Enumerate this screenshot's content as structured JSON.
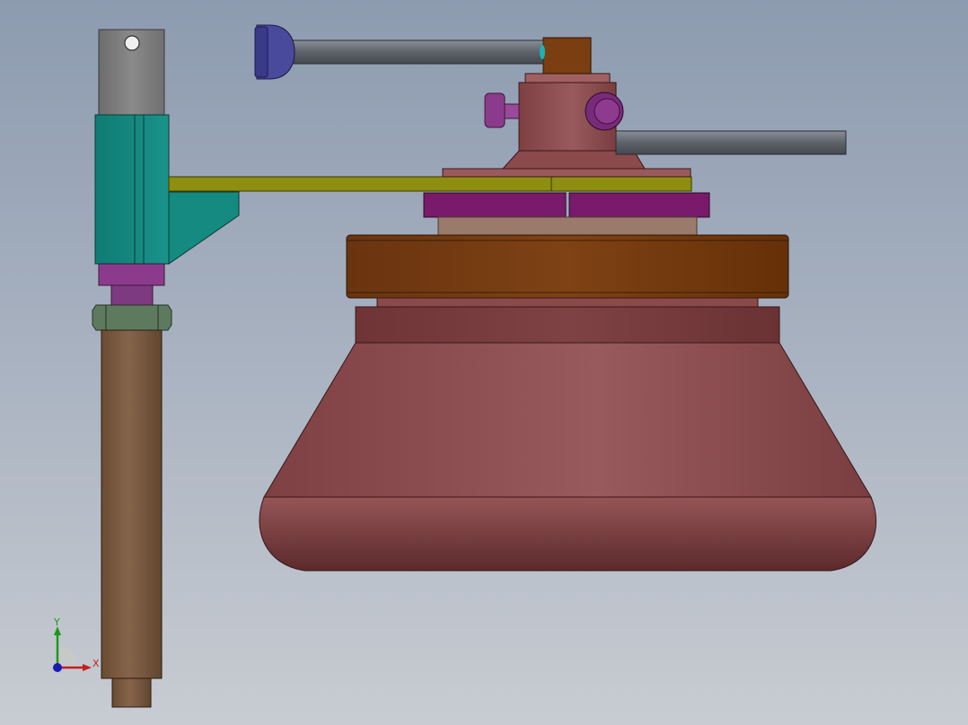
{
  "scene": {
    "view": "cad-3d-viewport",
    "colors": {
      "bg_top": "#8d9bb0",
      "bg_bottom": "#c8ccd2",
      "column_grey": "#7d7d7d",
      "clamp_teal": "#17897f",
      "clamp_purple": "#8c3a8c",
      "nut_green": "#5a7a5a",
      "column_brown": "#7a5a3e",
      "arm_olive": "#8a8a10",
      "base_rose": "#8c4a4c",
      "ring_orange": "#7a3e0c",
      "plate_magenta": "#7a1a6a",
      "handle_grey": "#5a5e66",
      "knob_blue": "#4a4a9c"
    }
  },
  "triad": {
    "x_label": "X",
    "y_label": "Y",
    "x_color": "#c41e1e",
    "y_color": "#1a9a1a",
    "z_color": "#1a1ab4"
  }
}
